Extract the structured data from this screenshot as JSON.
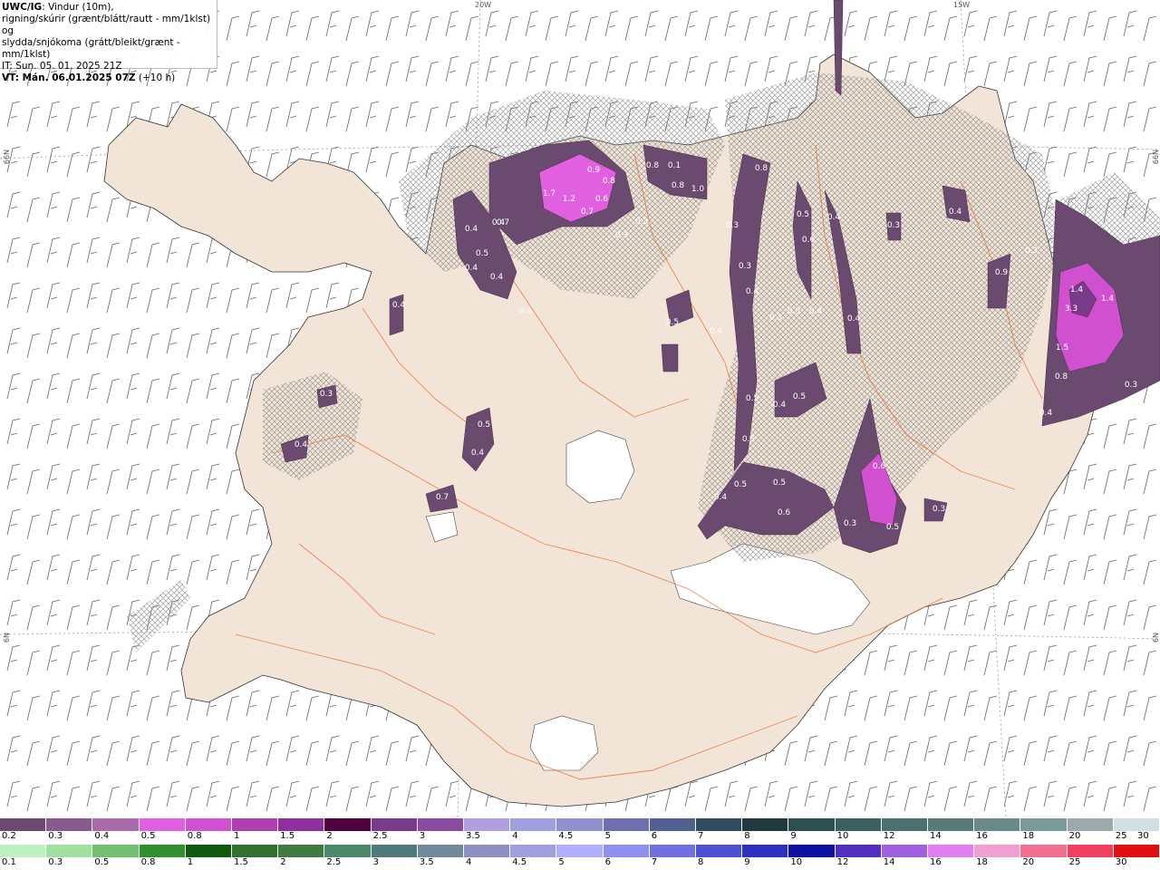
{
  "title": {
    "model": "UWC/IG",
    "description": ": Vindur (10m),",
    "line2": "rigning/skúrir (grænt/blátt/rautt - mm/1klst) og",
    "line3": "slydda/snjókoma (grátt/bleikt/grænt - mm/1klst)",
    "it": "IT: Sun. 05. 01. 2025 21Z",
    "vt": "VT: Mán. 06.01.2025 07Z",
    "vt_offset": " (+10 h)"
  },
  "graticule": {
    "lon_top": [
      "20W",
      "15W"
    ],
    "lat_left": [
      "N99",
      "N9"
    ],
    "lat_right": [
      "N99",
      "N9"
    ]
  },
  "precip_labels": [
    "0.4",
    "0.5",
    "0.4",
    "0.4",
    "0.7",
    "0.4",
    "0.9",
    "1.2",
    "1.7",
    "0.6",
    "0.8",
    "0.7",
    "0.3",
    "0.3",
    "0.8",
    "0.1",
    "0.8",
    "1.0",
    "0.3",
    "0.8",
    "0.5",
    "0.6",
    "0.3",
    "0.4",
    "0.3",
    "0.5",
    "0.4",
    "0.4",
    "0.4",
    "0.3",
    "0.4",
    "0.3",
    "0.4",
    "0.5",
    "0.4",
    "0.7",
    "0.4",
    "0.4",
    "0.5",
    "0.3",
    "0.4",
    "0.5",
    "0.5",
    "0.4",
    "0.6",
    "0.6",
    "0.3",
    "0.3",
    "0.5",
    "0.5",
    "0.9",
    "1.4",
    "1.4",
    "3.3",
    "1.5",
    "0.8",
    "0.4",
    "0.3",
    "0.3",
    "0.5",
    "0.4"
  ],
  "legend": {
    "snow_ticks": [
      "0.2",
      "0.3",
      "0.4",
      "0.5",
      "0.8",
      "1",
      "1.5",
      "2",
      "2.5",
      "3",
      "3.5",
      "4",
      "4.5",
      "5",
      "6",
      "7",
      "8",
      "9",
      "10",
      "12",
      "14",
      "16",
      "18",
      "20",
      "25",
      "30"
    ],
    "rain_ticks": [
      "0.1",
      "0.3",
      "0.5",
      "0.8",
      "1",
      "1.5",
      "2",
      "2.5",
      "3",
      "3.5",
      "4",
      "4.5",
      "5",
      "6",
      "7",
      "8",
      "9",
      "10",
      "12",
      "14",
      "16",
      "18",
      "20",
      "25",
      "30"
    ],
    "snow_colors": [
      "#6a4a6e",
      "#8a5a8e",
      "#a86aaa",
      "#e060e0",
      "#d050d0",
      "#b040b0",
      "#9030a0",
      "#500040",
      "#7a3a8a",
      "#8a4aa0",
      "#b0a0e0",
      "#a0a0e0",
      "#9090d0",
      "#7070b0",
      "#506090",
      "#304a60",
      "#203a40",
      "#2a5050",
      "#3a6060",
      "#4a7070",
      "#5a7a7a",
      "#6a8a8a",
      "#7a9a9a",
      "#9aaaaa",
      "#d0e0e0"
    ],
    "rain_colors": [
      "#c0f0c0",
      "#a0e0a0",
      "#70c070",
      "#309030",
      "#105a10",
      "#307030",
      "#407a40",
      "#4a8a6a",
      "#507a7a",
      "#708a9a",
      "#9090c0",
      "#a0a0e0",
      "#b0b0ff",
      "#9090f0",
      "#7070e0",
      "#5050d0",
      "#3030c0",
      "#1010a0",
      "#5030c0",
      "#a060e0",
      "#e080f0",
      "#f0a0d0",
      "#f07090",
      "#f04060",
      "#e01010"
    ]
  }
}
